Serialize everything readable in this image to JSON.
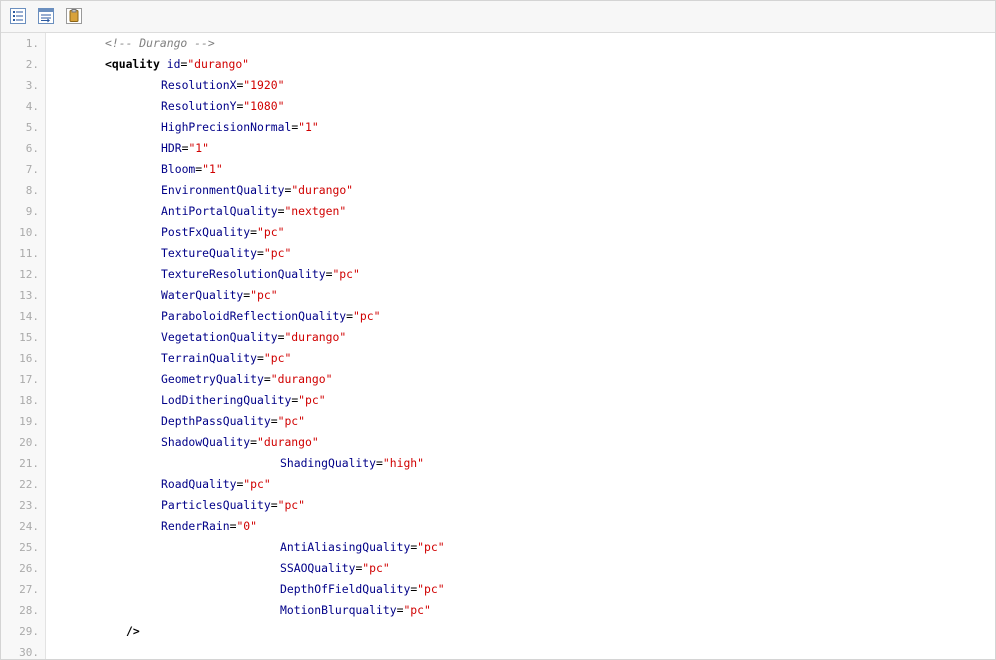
{
  "toolbar": {
    "buttons": [
      {
        "name": "view-source-icon"
      },
      {
        "name": "copy-to-clipboard-icon"
      },
      {
        "name": "print-icon"
      }
    ]
  },
  "colors": {
    "attribute": "#000088",
    "value": "#d00000",
    "comment": "#808080",
    "line_number": "#aaaaaa"
  },
  "lines": [
    {
      "n": "1.",
      "parts": [
        {
          "t": "cmt",
          "s": "<!-- Durango -->"
        }
      ]
    },
    {
      "n": "2.",
      "parts": [
        {
          "t": "tag",
          "s": "<quality"
        },
        {
          "t": "plain",
          "s": " "
        },
        {
          "t": "attr",
          "s": "id"
        },
        {
          "t": "eq",
          "s": "="
        },
        {
          "t": "val",
          "s": "\"durango\""
        }
      ]
    },
    {
      "n": "3.",
      "parts": [
        {
          "t": "attr",
          "s": "ResolutionX"
        },
        {
          "t": "eq",
          "s": "="
        },
        {
          "t": "val",
          "s": "\"1920\""
        }
      ]
    },
    {
      "n": "4.",
      "parts": [
        {
          "t": "attr",
          "s": "ResolutionY"
        },
        {
          "t": "eq",
          "s": "="
        },
        {
          "t": "val",
          "s": "\"1080\""
        }
      ]
    },
    {
      "n": "5.",
      "parts": [
        {
          "t": "attr",
          "s": "HighPrecisionNormal"
        },
        {
          "t": "eq",
          "s": "="
        },
        {
          "t": "val",
          "s": "\"1\""
        }
      ]
    },
    {
      "n": "6.",
      "parts": [
        {
          "t": "attr",
          "s": "HDR"
        },
        {
          "t": "eq",
          "s": "="
        },
        {
          "t": "val",
          "s": "\"1\""
        }
      ]
    },
    {
      "n": "7.",
      "parts": [
        {
          "t": "attr",
          "s": "Bloom"
        },
        {
          "t": "eq",
          "s": "="
        },
        {
          "t": "val",
          "s": "\"1\""
        }
      ]
    },
    {
      "n": "8.",
      "parts": [
        {
          "t": "attr",
          "s": "EnvironmentQuality"
        },
        {
          "t": "eq",
          "s": "="
        },
        {
          "t": "val",
          "s": "\"durango\""
        }
      ]
    },
    {
      "n": "9.",
      "parts": [
        {
          "t": "attr",
          "s": "AntiPortalQuality"
        },
        {
          "t": "eq",
          "s": "="
        },
        {
          "t": "val",
          "s": "\"nextgen\""
        }
      ]
    },
    {
      "n": "10.",
      "parts": [
        {
          "t": "attr",
          "s": "PostFxQuality"
        },
        {
          "t": "eq",
          "s": "="
        },
        {
          "t": "val",
          "s": "\"pc\""
        }
      ]
    },
    {
      "n": "11.",
      "parts": [
        {
          "t": "attr",
          "s": "TextureQuality"
        },
        {
          "t": "eq",
          "s": "="
        },
        {
          "t": "val",
          "s": "\"pc\""
        }
      ]
    },
    {
      "n": "12.",
      "parts": [
        {
          "t": "attr",
          "s": "TextureResolutionQuality"
        },
        {
          "t": "eq",
          "s": "="
        },
        {
          "t": "val",
          "s": "\"pc\""
        }
      ]
    },
    {
      "n": "13.",
      "parts": [
        {
          "t": "attr",
          "s": "WaterQuality"
        },
        {
          "t": "eq",
          "s": "="
        },
        {
          "t": "val",
          "s": "\"pc\""
        }
      ]
    },
    {
      "n": "14.",
      "parts": [
        {
          "t": "attr",
          "s": "ParaboloidReflectionQuality"
        },
        {
          "t": "eq",
          "s": "="
        },
        {
          "t": "val",
          "s": "\"pc\""
        }
      ]
    },
    {
      "n": "15.",
      "parts": [
        {
          "t": "attr",
          "s": "VegetationQuality"
        },
        {
          "t": "eq",
          "s": "="
        },
        {
          "t": "val",
          "s": "\"durango\""
        }
      ]
    },
    {
      "n": "16.",
      "parts": [
        {
          "t": "attr",
          "s": "TerrainQuality"
        },
        {
          "t": "eq",
          "s": "="
        },
        {
          "t": "val",
          "s": "\"pc\""
        }
      ]
    },
    {
      "n": "17.",
      "parts": [
        {
          "t": "attr",
          "s": "GeometryQuality"
        },
        {
          "t": "eq",
          "s": "="
        },
        {
          "t": "val",
          "s": "\"durango\""
        }
      ]
    },
    {
      "n": "18.",
      "parts": [
        {
          "t": "attr",
          "s": "LodDitheringQuality"
        },
        {
          "t": "eq",
          "s": "="
        },
        {
          "t": "val",
          "s": "\"pc\""
        }
      ]
    },
    {
      "n": "19.",
      "parts": [
        {
          "t": "attr",
          "s": "DepthPassQuality"
        },
        {
          "t": "eq",
          "s": "="
        },
        {
          "t": "val",
          "s": "\"pc\""
        }
      ]
    },
    {
      "n": "20.",
      "parts": [
        {
          "t": "attr",
          "s": "ShadowQuality"
        },
        {
          "t": "eq",
          "s": "="
        },
        {
          "t": "val",
          "s": "\"durango\""
        }
      ]
    },
    {
      "n": "21.",
      "parts": [
        {
          "t": "attr",
          "s": "ShadingQuality"
        },
        {
          "t": "eq",
          "s": "="
        },
        {
          "t": "val",
          "s": "\"high\""
        }
      ]
    },
    {
      "n": "22.",
      "parts": [
        {
          "t": "attr",
          "s": "RoadQuality"
        },
        {
          "t": "eq",
          "s": "="
        },
        {
          "t": "val",
          "s": "\"pc\""
        }
      ]
    },
    {
      "n": "23.",
      "parts": [
        {
          "t": "attr",
          "s": "ParticlesQuality"
        },
        {
          "t": "eq",
          "s": "="
        },
        {
          "t": "val",
          "s": "\"pc\""
        }
      ]
    },
    {
      "n": "24.",
      "parts": [
        {
          "t": "attr",
          "s": "RenderRain"
        },
        {
          "t": "eq",
          "s": "="
        },
        {
          "t": "val",
          "s": "\"0\""
        }
      ]
    },
    {
      "n": "25.",
      "parts": [
        {
          "t": "attr",
          "s": "AntiAliasingQuality"
        },
        {
          "t": "eq",
          "s": "="
        },
        {
          "t": "val",
          "s": "\"pc\""
        }
      ]
    },
    {
      "n": "26.",
      "parts": [
        {
          "t": "attr",
          "s": "SSAOQuality"
        },
        {
          "t": "eq",
          "s": "="
        },
        {
          "t": "val",
          "s": "\"pc\""
        }
      ]
    },
    {
      "n": "27.",
      "parts": [
        {
          "t": "attr",
          "s": "DepthOfFieldQuality"
        },
        {
          "t": "eq",
          "s": "="
        },
        {
          "t": "val",
          "s": "\"pc\""
        }
      ]
    },
    {
      "n": "28.",
      "parts": [
        {
          "t": "attr",
          "s": "MotionBlurquality"
        },
        {
          "t": "eq",
          "s": "="
        },
        {
          "t": "val",
          "s": "\"pc\""
        }
      ]
    },
    {
      "n": "29.",
      "parts": [
        {
          "t": "tag",
          "s": "/>"
        }
      ]
    },
    {
      "n": "30.",
      "parts": []
    }
  ]
}
